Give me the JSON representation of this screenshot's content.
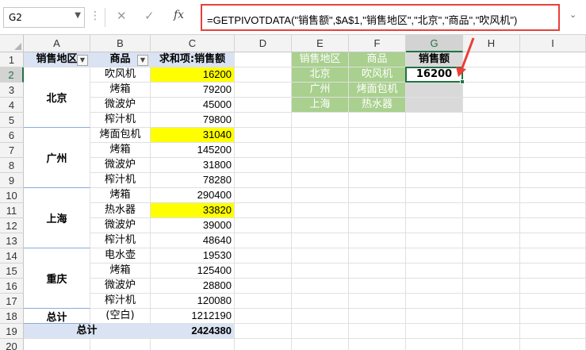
{
  "namebox": {
    "value": "G2"
  },
  "formula": {
    "text": "=GETPIVOTDATA(\"销售额\",$A$1,\"销售地区\",\"北京\",\"商品\",\"吹风机\")"
  },
  "icons": {
    "cancel": "close-icon",
    "enter": "check-icon",
    "fx": "function-icon"
  },
  "columns": [
    "A",
    "B",
    "C",
    "D",
    "E",
    "F",
    "G",
    "H",
    "I"
  ],
  "rows": [
    "1",
    "2",
    "3",
    "4",
    "5",
    "6",
    "7",
    "8",
    "9",
    "10",
    "11",
    "12",
    "13",
    "14",
    "15",
    "16",
    "17",
    "18",
    "19",
    "20"
  ],
  "pivot": {
    "header": {
      "region": "销售地区",
      "product": "商品",
      "sum": "求和项:销售额"
    },
    "groups": [
      {
        "region": "北京",
        "items": [
          {
            "product": "吹风机",
            "value": "16200",
            "highlight": true
          },
          {
            "product": "烤箱",
            "value": "79200"
          },
          {
            "product": "微波炉",
            "value": "45000"
          },
          {
            "product": "榨汁机",
            "value": "79800"
          }
        ]
      },
      {
        "region": "广州",
        "items": [
          {
            "product": "烤面包机",
            "value": "31040",
            "highlight": true
          },
          {
            "product": "烤箱",
            "value": "145200"
          },
          {
            "product": "微波炉",
            "value": "31800"
          },
          {
            "product": "榨汁机",
            "value": "78280"
          }
        ]
      },
      {
        "region": "上海",
        "items": [
          {
            "product": "烤箱",
            "value": "290400"
          },
          {
            "product": "热水器",
            "value": "33820",
            "highlight": true
          },
          {
            "product": "微波炉",
            "value": "39000"
          },
          {
            "product": "榨汁机",
            "value": "48640"
          }
        ]
      },
      {
        "region": "重庆",
        "items": [
          {
            "product": "电水壶",
            "value": "19530"
          },
          {
            "product": "烤箱",
            "value": "125400"
          },
          {
            "product": "微波炉",
            "value": "28800"
          },
          {
            "product": "榨汁机",
            "value": "120080"
          }
        ]
      },
      {
        "region": "总计",
        "items": [
          {
            "product": "(空白)",
            "value": "1212190"
          }
        ]
      }
    ],
    "grand_total": {
      "label": "总计",
      "value": "2424380"
    }
  },
  "lookup": {
    "header": {
      "region": "销售地区",
      "product": "商品",
      "sales": "销售额"
    },
    "rows": [
      {
        "region": "北京",
        "product": "吹风机",
        "sales": "16200"
      },
      {
        "region": "广州",
        "product": "烤面包机",
        "sales": ""
      },
      {
        "region": "上海",
        "product": "热水器",
        "sales": ""
      }
    ]
  },
  "colors": {
    "accent": "#217346",
    "formula_border": "#e8403a",
    "highlight": "#ffff00",
    "lookup_header": "#a9d08e",
    "pivot_header": "#dae3f3"
  }
}
